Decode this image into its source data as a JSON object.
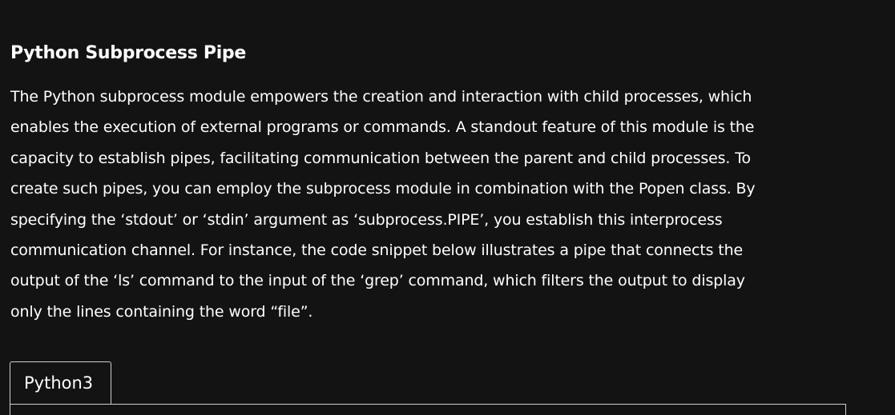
{
  "article": {
    "title": "Python Subprocess Pipe",
    "paragraph_lines": [
      "The Python subprocess module empowers the creation and interaction with child processes, which",
      "enables the execution of external programs or commands. A standout feature of this module is the",
      "capacity to establish pipes, facilitating communication between the parent and child processes. To",
      "create such pipes, you can employ the subprocess module in combination with the Popen class. By",
      "specifying the ‘stdout’ or ‘stdin’ argument as ‘subprocess.PIPE’, you establish this interprocess",
      "communication channel. For instance, the code snippet below illustrates a pipe that connects the",
      "output of the ‘ls’ command to the input of the ‘grep’ command, which filters the output to display",
      "only the lines containing the word “file”."
    ]
  },
  "code_tabs": {
    "active_tab_label": "Python3"
  }
}
